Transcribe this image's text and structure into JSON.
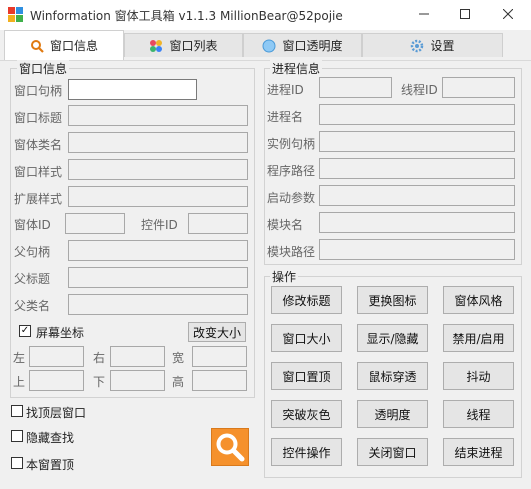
{
  "window": {
    "title": "Winformation 窗体工具箱 v1.1.3  MillionBear@52pojie"
  },
  "tabs": [
    {
      "label": "窗口信息",
      "icon": "search-icon"
    },
    {
      "label": "窗口列表",
      "icon": "grid-icon"
    },
    {
      "label": "窗口透明度",
      "icon": "globe-icon"
    },
    {
      "label": "设置",
      "icon": "gear-icon"
    }
  ],
  "window_info": {
    "group_label": "窗口信息",
    "handle_label": "窗口句柄",
    "title_label": "窗口标题",
    "class_label": "窗体类名",
    "style_label": "窗口样式",
    "ex_style_label": "扩展样式",
    "form_id_label": "窗体ID",
    "control_id_label": "控件ID",
    "parent_handle_label": "父句柄",
    "parent_title_label": "父标题",
    "parent_class_label": "父类名",
    "screen_coords_label": "屏幕坐标",
    "screen_coords_checked": true,
    "resize_button": "改变大小",
    "left_label": "左",
    "right_label": "右",
    "width_label": "宽",
    "top_label": "上",
    "bottom_label": "下",
    "height_label": "高"
  },
  "process_info": {
    "group_label": "进程信息",
    "process_id_label": "进程ID",
    "thread_id_label": "线程ID",
    "process_name_label": "进程名",
    "instance_handle_label": "实例句柄",
    "process_path_label": "程序路径",
    "start_args_label": "启动参数",
    "module_name_label": "模块名",
    "module_path_label": "模块路径"
  },
  "operations": {
    "group_label": "操作",
    "buttons": [
      "修改标题",
      "更换图标",
      "窗体风格",
      "窗口大小",
      "显示/隐藏",
      "禁用/启用",
      "窗口置顶",
      "鼠标穿透",
      "抖动",
      "突破灰色",
      "透明度",
      "线程",
      "控件操作",
      "关闭窗口",
      "结束进程"
    ]
  },
  "options": [
    {
      "label": "找顶层窗口",
      "checked": false
    },
    {
      "label": "隐藏查找",
      "checked": false
    },
    {
      "label": "本窗置顶",
      "checked": false
    }
  ],
  "colors": {
    "accent_orange": "#f5912c",
    "tab_active": "#ffffff",
    "background": "#f0f0f0"
  }
}
